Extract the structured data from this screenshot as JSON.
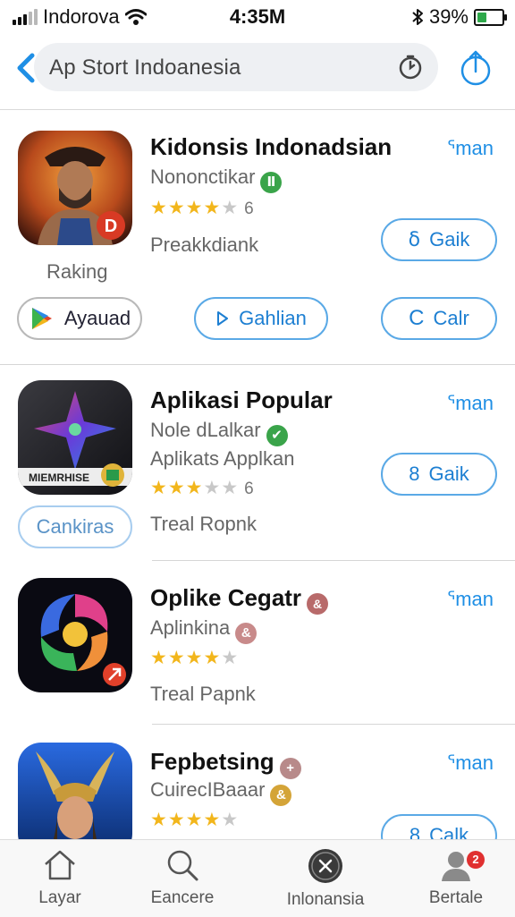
{
  "status_bar": {
    "carrier": "Indorova",
    "time": "4:35M",
    "battery_percent": "39%",
    "battery_level": 0.39
  },
  "search": {
    "query": "Ap Stort  Indoanesia",
    "back_icon": "chevron-left-icon",
    "history_icon": "clock-icon",
    "share_icon": "share-icon"
  },
  "apps": [
    {
      "title": "Kidonsis Indonadsian",
      "developer": "Nononctikar",
      "badge_glyph": "Ⅱ",
      "badge_color": "#3aa44a",
      "rating": 4,
      "rating_count": "6",
      "extra_line": "Preakkdiank",
      "action_link": "ᕐman",
      "get_label": "Gaik",
      "get_glyph": "ẟ",
      "icon_caption": "Raking",
      "secondary_buttons": [
        {
          "label": "Ayauad",
          "icon": "play-store-icon"
        },
        {
          "label": "Gahlian",
          "icon": "play-outline-icon"
        },
        {
          "label": "Calr",
          "icon": "c-icon"
        }
      ]
    },
    {
      "title": "Aplikasi Popular",
      "developer": "Nole ԁLalkar",
      "badge_glyph": "✔",
      "badge_color": "#3aa44a",
      "subtitle": "Aplikats Applkan",
      "rating": 3,
      "rating_count": "6",
      "extra_line": "Treal Ropnk",
      "action_link": "ᕐman",
      "get_label": "Gaik",
      "get_glyph": "8",
      "icon_text": "MIEMRHISE",
      "icon_caption_button": "Cankiras"
    },
    {
      "title": "Oplike Cegatr",
      "title_badge": "&",
      "title_badge_color": "#b86a6a",
      "developer": "Aplinkina",
      "badge_glyph": "&",
      "badge_color": "#c88a8a",
      "rating": 4,
      "rating_count": "",
      "extra_line": "Treal Papnk",
      "action_link": "ᕐman"
    },
    {
      "title": "Fepbetsing",
      "title_badge": "+",
      "title_badge_color": "#b88a8a",
      "developer": "CuirecIBaaar",
      "badge_glyph": "&",
      "badge_color": "#d4a438",
      "rating": 4,
      "action_link": "ᕐman",
      "get_label": "Calk",
      "get_glyph": "8"
    }
  ],
  "tabs": [
    {
      "label": "Layar",
      "icon": "home-icon"
    },
    {
      "label": "Eancere",
      "icon": "search-icon"
    },
    {
      "label": "Inlonansia",
      "icon": "close-circle-icon"
    },
    {
      "label": "Bertale",
      "icon": "profile-icon",
      "badge": "2"
    }
  ],
  "colors": {
    "accent": "#1f8fe5",
    "star": "#f2b61c",
    "notification": "#e03030"
  }
}
